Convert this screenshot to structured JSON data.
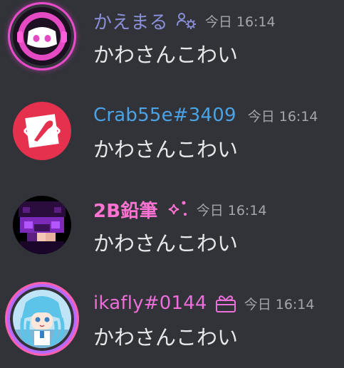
{
  "messages": [
    {
      "username": "かえまる",
      "username_color": "#8a8fd8",
      "badge_icon": "role-settings-icon",
      "timestamp": "今日 16:14",
      "content": "かわさんこわい",
      "avatar": "discord-logo-avatar"
    },
    {
      "username": "Crab55e#3409",
      "username_color": "#4aa3e6",
      "timestamp": "今日 16:14",
      "content": "かわさんこわい",
      "avatar": "crab-tag-avatar"
    },
    {
      "username": "2B鉛筆",
      "username_color": "#ff73d2",
      "badge_icon": "sparkle-icon",
      "timestamp": "今日 16:14",
      "content": "かわさんこわい",
      "avatar": "pixel-character-avatar"
    },
    {
      "username": "ikafly#0144",
      "username_color": "#ec6ed8",
      "badge_icon": "gift-icon",
      "timestamp": "今日 16:14",
      "content": "かわさんこわい",
      "avatar": "anime-squid-girl-avatar"
    }
  ]
}
